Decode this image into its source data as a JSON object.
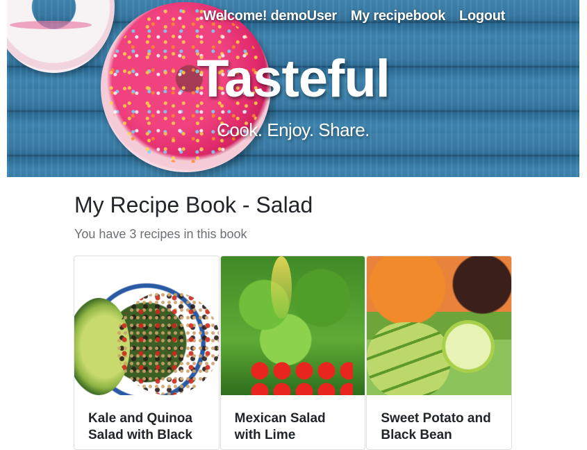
{
  "header": {
    "nav": {
      "welcome": "Welcome! demoUser",
      "recipebook": "My recipebook",
      "logout": "Logout"
    },
    "title": "Tasteful",
    "tagline": "Cook. Enjoy. Share."
  },
  "main": {
    "title": "My Recipe Book - Salad",
    "subtitle": "You have 3 recipes in this book",
    "recipes": [
      {
        "title": "Kale and Quinoa Salad with Black"
      },
      {
        "title": "Mexican Salad with Lime"
      },
      {
        "title": "Sweet Potato and Black Bean"
      }
    ]
  }
}
